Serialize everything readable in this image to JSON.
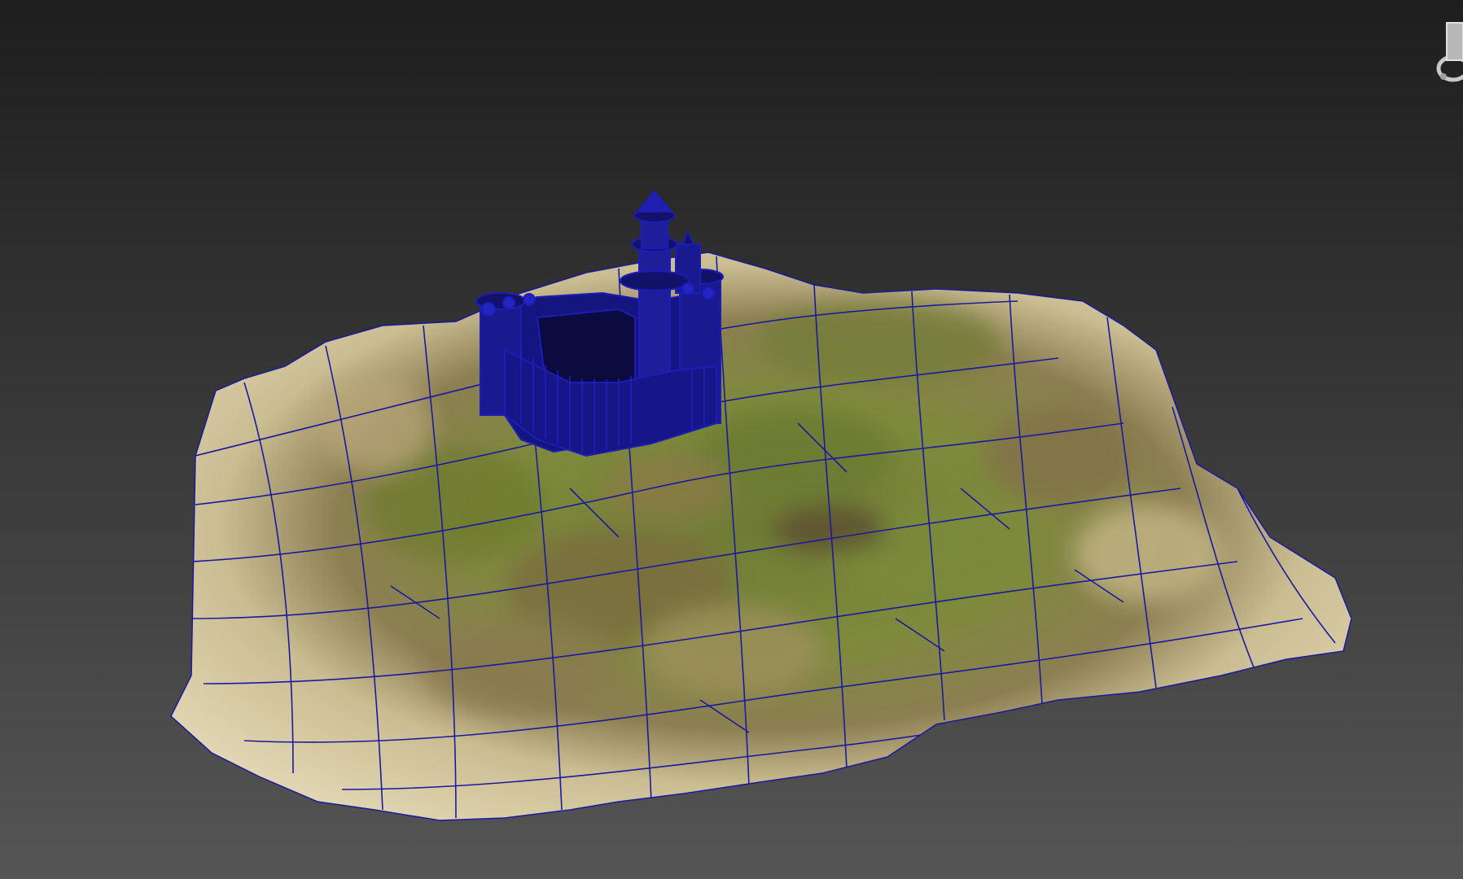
{
  "viewport": {
    "background_top": "#1e1e1e",
    "background_bottom": "#545454",
    "wireframe_color": "#1a1a9e",
    "castle_color": "#1c1cb8",
    "terrain_sand": "#d9cfa6",
    "terrain_grass": "#7d8a3a",
    "terrain_dirt": "#8a6a45"
  },
  "scene": {
    "terrain": "terrain-mesh",
    "building": "castle-model"
  },
  "viewcube": {
    "icon": "viewcube-icon"
  }
}
